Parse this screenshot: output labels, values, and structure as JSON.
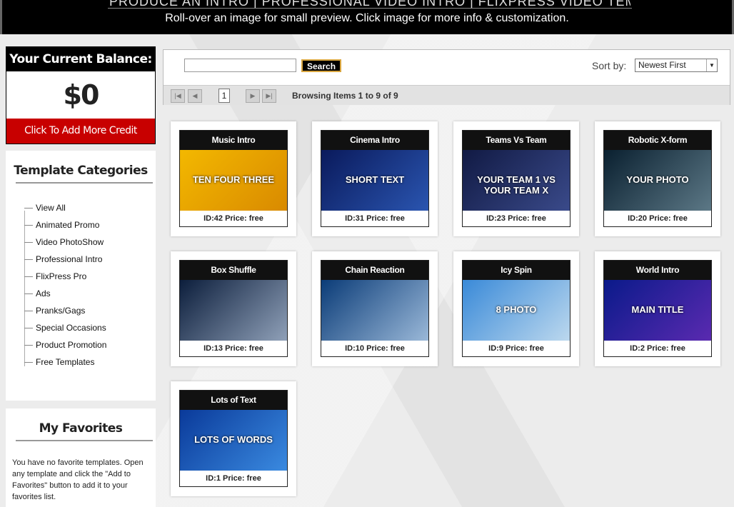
{
  "header": {
    "title_cut": "PRODUCE AN INTRO | PROFESSIONAL VIDEO INTRO | FLIXPRESS VIDEO TEMPLATES",
    "subtitle": "Roll-over an image for small preview. Click image for more info & customization."
  },
  "balance": {
    "heading": "Your Current Balance:",
    "amount": "$0",
    "add_credit": "Click To Add More Credit",
    "colors": {
      "header": "#000000",
      "credit_button": "#c80000"
    }
  },
  "categories": {
    "heading": "Template Categories",
    "items": [
      "View All",
      "Animated Promo",
      "Video PhotoShow",
      "Professional Intro",
      "FlixPress Pro",
      "Ads",
      "Pranks/Gags",
      "Special Occasions",
      "Product Promotion",
      "Free Templates"
    ]
  },
  "favorites": {
    "heading": "My Favorites",
    "text": "You have no favorite templates. Open any template and click the \"Add to Favorites\" button to add it to your favorites list."
  },
  "search": {
    "button": "Search",
    "value": ""
  },
  "sort": {
    "label": "Sort by:",
    "selected": "Newest First"
  },
  "pager": {
    "first": "|◀",
    "prev": "◀",
    "next": "▶",
    "last": "▶|",
    "page": "1",
    "browsing": "Browsing Items 1 to 9 of 9"
  },
  "templates": [
    {
      "title": "Music Intro",
      "meta": "ID:42   Price: free",
      "thumb_text": "TEN FOUR THREE",
      "colors": [
        "#f3b800",
        "#d98a00"
      ]
    },
    {
      "title": "Cinema Intro",
      "meta": "ID:31   Price: free",
      "thumb_text": "SHORT TEXT",
      "colors": [
        "#0a1a5c",
        "#2a55b0"
      ]
    },
    {
      "title": "Teams Vs Team",
      "meta": "ID:23   Price: free",
      "thumb_text": "YOUR TEAM 1 VS YOUR TEAM X",
      "colors": [
        "#111a44",
        "#3a4a8a"
      ]
    },
    {
      "title": "Robotic X-form",
      "meta": "ID:20   Price: free",
      "thumb_text": "YOUR PHOTO",
      "colors": [
        "#0a2030",
        "#5c7886"
      ]
    },
    {
      "title": "Box Shuffle",
      "meta": "ID:13   Price: free",
      "thumb_text": "",
      "colors": [
        "#0c1e3c",
        "#8fa0b8"
      ]
    },
    {
      "title": "Chain Reaction",
      "meta": "ID:10   Price: free",
      "thumb_text": "",
      "colors": [
        "#0b3c78",
        "#9ab8d8"
      ]
    },
    {
      "title": "Icy Spin",
      "meta": "ID:9   Price: free",
      "thumb_text": "8 PHOTO",
      "colors": [
        "#3a8ad8",
        "#bcd8ee"
      ]
    },
    {
      "title": "World Intro",
      "meta": "ID:2   Price: free",
      "thumb_text": "MAIN TITLE",
      "colors": [
        "#0a1a8a",
        "#5a2ab0"
      ]
    },
    {
      "title": "Lots of Text",
      "meta": "ID:1   Price: free",
      "thumb_text": "LOTS OF WORDS",
      "colors": [
        "#0a3a9a",
        "#3a8ae0"
      ]
    }
  ]
}
